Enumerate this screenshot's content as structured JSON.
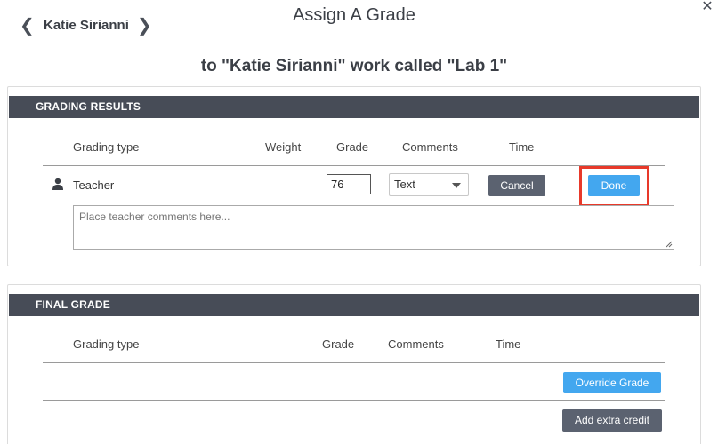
{
  "header": {
    "student_name": "Katie Sirianni",
    "title": "Assign A Grade",
    "subtitle": "to \"Katie Sirianni\" work called \"Lab 1\"",
    "prev_glyph": "❮",
    "next_glyph": "❯",
    "close_glyph": "✕"
  },
  "grading_results": {
    "header": "GRADING RESULTS",
    "columns": {
      "grading_type": "Grading type",
      "weight": "Weight",
      "grade": "Grade",
      "comments": "Comments",
      "time": "Time"
    },
    "row": {
      "icon": "person-icon",
      "label": "Teacher",
      "grade_value": "76",
      "comment_type": "Text",
      "cancel_label": "Cancel",
      "done_label": "Done"
    },
    "comments_placeholder": "Place teacher comments here..."
  },
  "final_grade": {
    "header": "FINAL GRADE",
    "columns": {
      "grading_type": "Grading type",
      "grade": "Grade",
      "comments": "Comments",
      "time": "Time"
    },
    "override_label": "Override Grade",
    "extra_credit_label": "Add extra credit"
  },
  "colors": {
    "header_bar": "#474c57",
    "primary_button": "#43a7ef",
    "secondary_button": "#5b6270",
    "highlight": "#e8392a"
  }
}
